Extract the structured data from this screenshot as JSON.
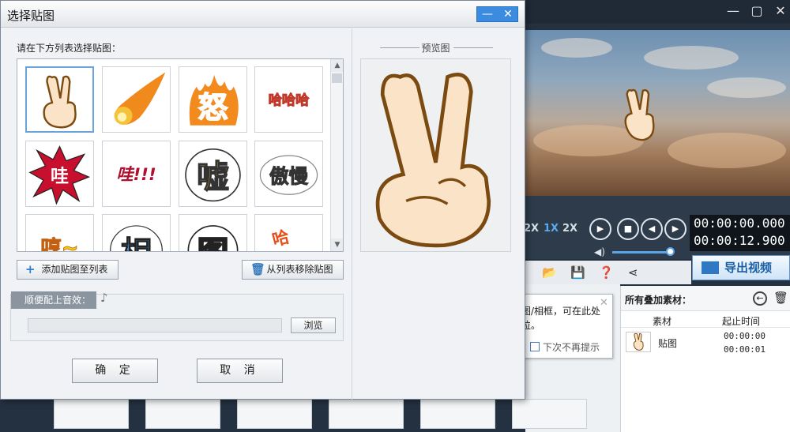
{
  "dialog": {
    "title": "选择贴图",
    "minimize_glyph": "—",
    "close_glyph": "✕",
    "list_label": "请在下方列表选择贴图：",
    "stickers": [
      {
        "name": "peace-hand",
        "text": ""
      },
      {
        "name": "fireball",
        "text": ""
      },
      {
        "name": "anger",
        "text": "怒"
      },
      {
        "name": "haha",
        "text": "哈哈哈"
      },
      {
        "name": "wa-burst",
        "text": "哇"
      },
      {
        "name": "wa-exclaim",
        "text": "哇!!!"
      },
      {
        "name": "xu",
        "text": "嘘"
      },
      {
        "name": "aoman",
        "text": "傲慢"
      },
      {
        "name": "heng",
        "text": "哼~"
      },
      {
        "name": "xiang",
        "text": "相"
      },
      {
        "name": "tu",
        "text": "图"
      },
      {
        "name": "ha-small",
        "text": "哈"
      }
    ],
    "add_button": "添加贴图至列表",
    "remove_button": "从列表移除贴图",
    "sound_label": "顺便配上音效：",
    "sound_path": "",
    "browse_button": "浏览",
    "ok_button": "确 定",
    "cancel_button": "取 消",
    "preview_title": "预览图",
    "colors": {
      "accent": "#3b8be0",
      "sticker_orange": "#f0a020",
      "sticker_red": "#c8102e"
    }
  },
  "app": {
    "speeds": [
      "2X",
      "1X",
      "2X"
    ],
    "timecode_current": "00:00:00.000",
    "timecode_total": "00:00:12.900",
    "export_button": "导出视频",
    "materials_title": "所有叠加素材：",
    "col_material": "素材",
    "col_time": "起止时间",
    "material_rows": [
      {
        "name": "贴图",
        "start": "00:00:00",
        "end": "00:00:01"
      }
    ]
  },
  "tooltip": {
    "text": "您若添加了贴图/相框，可在此处快速检索与定位。",
    "checkbox_label": "下次不再提示"
  }
}
